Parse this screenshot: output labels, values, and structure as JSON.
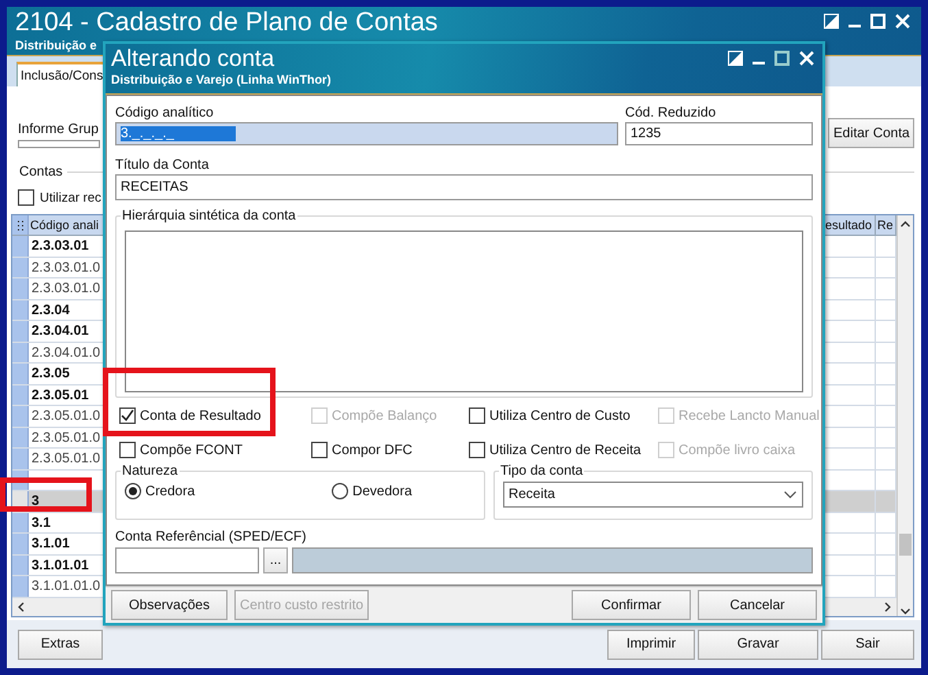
{
  "window": {
    "title": "2104 - Cadastro de Plano de Contas",
    "subtitle": "Distribuição e"
  },
  "tabs": [
    {
      "label": "Inclusão/Cons",
      "selected": true
    }
  ],
  "group_filter": {
    "label": "Informe Grup"
  },
  "edit_button": "Editar Conta",
  "accounts": {
    "label": "Contas",
    "checkbox": {
      "label": "Utilizar rec",
      "checked": false
    }
  },
  "table": {
    "columns": [
      "Código anali",
      "esultado",
      "Re"
    ],
    "rows": [
      {
        "code": "2.3.03.01",
        "kind": "synthetic",
        "selected": false
      },
      {
        "code": "2.3.03.01.0",
        "kind": "analytic",
        "selected": false
      },
      {
        "code": "2.3.03.01.0",
        "kind": "analytic",
        "selected": false
      },
      {
        "code": "2.3.04",
        "kind": "synthetic",
        "selected": false
      },
      {
        "code": "2.3.04.01",
        "kind": "synthetic",
        "selected": false
      },
      {
        "code": "2.3.04.01.0",
        "kind": "analytic",
        "selected": false
      },
      {
        "code": "2.3.05",
        "kind": "synthetic",
        "selected": false
      },
      {
        "code": "2.3.05.01",
        "kind": "synthetic",
        "selected": false
      },
      {
        "code": "2.3.05.01.0",
        "kind": "analytic",
        "selected": false
      },
      {
        "code": "2.3.05.01.0",
        "kind": "analytic",
        "selected": false
      },
      {
        "code": "2.3.05.01.0",
        "kind": "analytic",
        "selected": false
      },
      {
        "selected": false
      },
      {
        "code": "3",
        "kind": "synthetic",
        "selected": true
      },
      {
        "code": "3.1",
        "kind": "synthetic",
        "selected": false
      },
      {
        "code": "3.1.01",
        "kind": "synthetic",
        "selected": false
      },
      {
        "code": "3.1.01.01",
        "kind": "synthetic",
        "selected": false
      },
      {
        "code": "3.1.01.01.0",
        "kind": "analytic",
        "selected": false
      }
    ]
  },
  "buttons": [
    "Extras",
    "Imprimir",
    "Gravar",
    "Sair"
  ],
  "dialog": {
    "title": "Alterando conta",
    "subtitle": "Distribuição e Varejo (Linha WinThor)",
    "code": {
      "label": "Código analítico",
      "value": "3._._._._"
    },
    "short_code": {
      "label": "Cód. Reduzido",
      "value": "1235"
    },
    "account_title": {
      "label": "Título da Conta",
      "value": "RECEITAS"
    },
    "hierarchy": {
      "label": "Hierárquia sintética da conta"
    },
    "options": [
      {
        "label": "Conta de Resultado",
        "checked": true,
        "disabled": false
      },
      {
        "label": "Compõe Balanço",
        "checked": false,
        "disabled": true
      },
      {
        "label": "Utiliza Centro de Custo",
        "checked": false,
        "disabled": false
      },
      {
        "label": "Recebe Lancto Manual",
        "checked": false,
        "disabled": true
      },
      {
        "label": "Compõe FCONT",
        "checked": false,
        "disabled": false
      },
      {
        "label": "Compor DFC",
        "checked": false,
        "disabled": false
      },
      {
        "label": "Utiliza Centro de Receita",
        "checked": false,
        "disabled": false
      },
      {
        "label": "Compõe livro caixa",
        "checked": false,
        "disabled": true
      }
    ],
    "nature": {
      "label": "Natureza",
      "options": [
        {
          "label": "Credora",
          "selected": true
        },
        {
          "label": "Devedora",
          "selected": false
        }
      ]
    },
    "account_type": {
      "label": "Tipo da conta",
      "value": "Receita"
    },
    "reference": {
      "label": "Conta Referêncial (SPED/ECF)",
      "button": "..."
    },
    "buttons": [
      {
        "label": "Observações",
        "disabled": false
      },
      {
        "label": "Centro custo restrito",
        "disabled": true
      },
      {
        "label": "Confirmar",
        "disabled": false
      },
      {
        "label": "Cancelar",
        "disabled": false
      }
    ]
  }
}
